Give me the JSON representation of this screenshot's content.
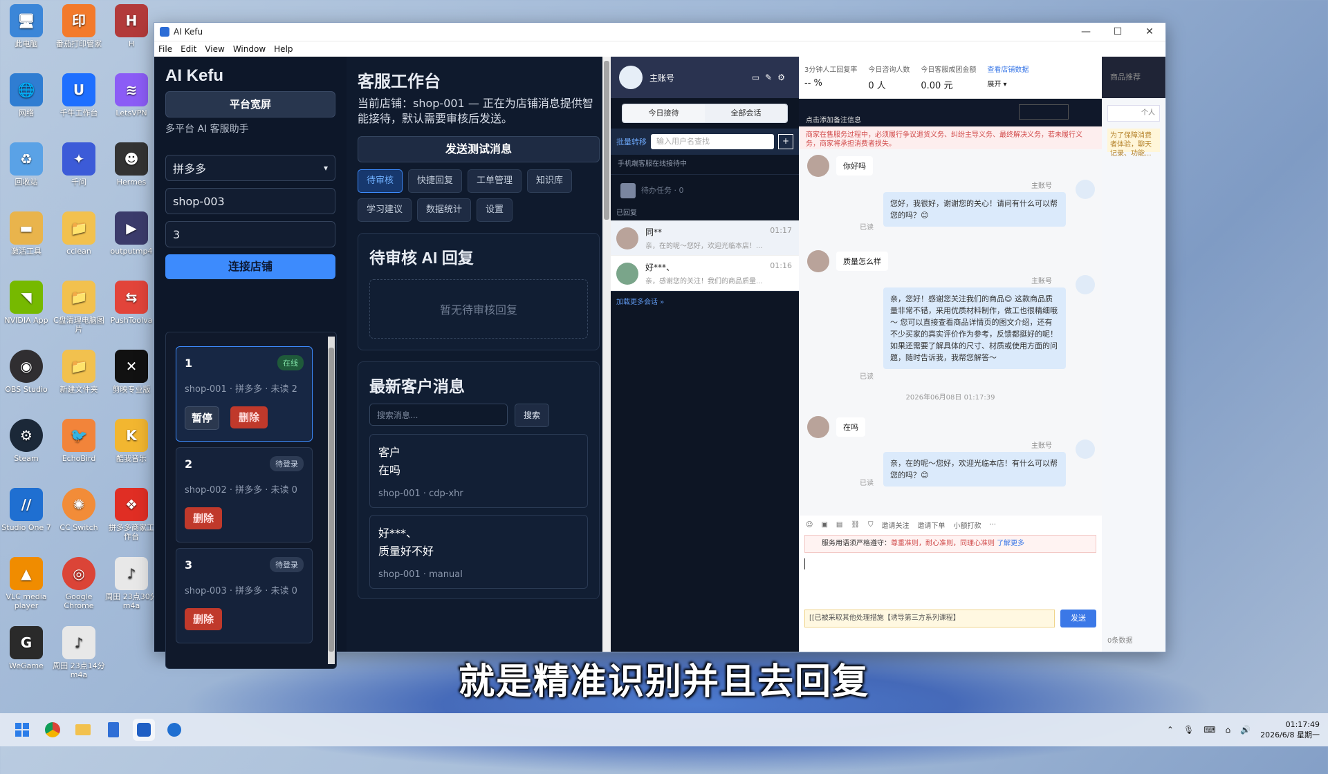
{
  "desktop": {
    "icons": [
      {
        "label": "此电脑",
        "color": "#3b86d8"
      },
      {
        "label": "番茄打印管家",
        "color": "#f37a2b"
      },
      {
        "label": "H",
        "color": "#b23a3a"
      },
      {
        "label": "网络",
        "color": "#2f7dd2"
      },
      {
        "label": "千牛工作台",
        "color": "#1e6fff"
      },
      {
        "label": "LetsVPN",
        "color": "#8b5cf6"
      },
      {
        "label": "回收站",
        "color": "#5aa2e6"
      },
      {
        "label": "千问",
        "color": "#3c5bd8"
      },
      {
        "label": "Hermes",
        "color": "#333333"
      },
      {
        "label": "激活工具",
        "color": "#e9b44c"
      },
      {
        "label": "cclean",
        "color": "#f2c14e"
      },
      {
        "label": "outputmp4",
        "color": "#3b3b6b"
      },
      {
        "label": "NVIDIA App",
        "color": "#76b900"
      },
      {
        "label": "C盘清理电脑图片",
        "color": "#f2c14e"
      },
      {
        "label": "PushToolva",
        "color": "#e2443a"
      },
      {
        "label": "OBS Studio",
        "color": "#302e31"
      },
      {
        "label": "新建文件夹",
        "color": "#f2c14e"
      },
      {
        "label": "剪映专业版",
        "color": "#111111"
      },
      {
        "label": "Steam",
        "color": "#1b2838"
      },
      {
        "label": "EchoBird",
        "color": "#f2843a"
      },
      {
        "label": "酷我音乐",
        "color": "#f2b630"
      },
      {
        "label": "Studio One 7",
        "color": "#1f6fd1"
      },
      {
        "label": "CC Switch",
        "color": "#f28c38"
      },
      {
        "label": "拼多多商家工作台",
        "color": "#e02e24"
      },
      {
        "label": "VLC media player",
        "color": "#f08c00"
      },
      {
        "label": "Google Chrome",
        "color": "#db4437"
      },
      {
        "label": "周田 23点30分m4a",
        "color": "#e8e8e8"
      },
      {
        "label": "WeGame",
        "color": "#2a2a2a"
      },
      {
        "label": "周田 23点14分m4a",
        "color": "#e8e8e8"
      }
    ]
  },
  "window": {
    "title": "AI Kefu",
    "menu": [
      "File",
      "Edit",
      "View",
      "Window",
      "Help"
    ],
    "controls": {
      "minimize": "—",
      "maximize": "☐",
      "close": "✕"
    }
  },
  "sidebar": {
    "brand": "AI Kefu",
    "wide_button": "平台宽屏",
    "subtitle": "多平台 AI 客服助手",
    "platform_select": "拼多多",
    "shop_id_value": "shop-003",
    "count_value": "3",
    "connect_button": "连接店铺",
    "shops": [
      {
        "num": "1",
        "status": "在线",
        "meta": "shop-001 · 拼多多 · 未读 2",
        "pause": "暂停",
        "delete": "删除"
      },
      {
        "num": "2",
        "status": "待登录",
        "meta": "shop-002 · 拼多多 · 未读 0",
        "delete": "删除"
      },
      {
        "num": "3",
        "status": "待登录",
        "meta": "shop-003 · 拼多多 · 未读 0",
        "delete": "删除"
      }
    ]
  },
  "middle": {
    "title": "客服工作台",
    "description": "当前店铺：shop-001 — 正在为店铺消息提供智能接待，默认需要审核后发送。",
    "send_test_button": "发送测试消息",
    "tabs": [
      "待审核",
      "快捷回复",
      "工单管理",
      "知识库",
      "学习建议",
      "数据统计",
      "设置"
    ],
    "pending_card": {
      "title": "待审核 AI 回复",
      "empty": "暂无待审核回复"
    },
    "latest_card": {
      "title": "最新客户消息",
      "search_placeholder": "搜索消息...",
      "search_button": "搜索",
      "messages": [
        {
          "who": "客户",
          "text": "在吗",
          "source": "shop-001 · cdp-xhr"
        },
        {
          "who": "好***、",
          "text": "质量好不好",
          "source": "shop-001 · manual"
        }
      ]
    }
  },
  "chat_app": {
    "account": "主账号",
    "segments": [
      "今日接待",
      "全部会话"
    ],
    "batch_transfer": "批量转移",
    "search_placeholder": "输入用户名查找",
    "mobile_notice": "手机端客服在线接待中",
    "pending_task": "待办任务 · 0",
    "replied_label": "已回复",
    "conversations": [
      {
        "name": "同**",
        "time": "01:17",
        "preview": "亲，在的呢～您好，欢迎光临本店！..."
      },
      {
        "name": "好***、",
        "time": "01:16",
        "preview": "亲，感谢您的关注！我们的商品质量..."
      }
    ],
    "load_more": "加载更多会话 »",
    "stats": [
      {
        "label": "3分钟人工回复率",
        "value": "-- %"
      },
      {
        "label": "今日咨询人数",
        "value": "0 人"
      },
      {
        "label": "今日客服成团金额",
        "value": "0.00 元"
      }
    ],
    "store_data_link": "查看店铺数据",
    "expand": "展开 ▾",
    "add_note": "点击添加备注信息",
    "warning": "商家在售服务过程中，必须履行争议退货义务、纠纷主导义务、最终解决义务，若未履行义务，商家将承担消费者损失。",
    "chat": {
      "msg1": "你好吗",
      "seller_label": "主账号",
      "reply1": "您好，我很好，谢谢您的关心！请问有什么可以帮您的吗？😊",
      "read": "已读",
      "msg2": "质量怎么样",
      "reply2": "亲，您好！感谢您关注我们的商品😊 这款商品质量非常不错，采用优质材料制作，做工也很精细哦～ 您可以直接查看商品详情页的图文介绍，还有不少买家的真实评价作为参考，反馈都挺好的呢！如果还需要了解具体的尺寸、材质或使用方面的问题，随时告诉我，我帮您解答～",
      "timestamp": "2026年06月08日 01:17:39",
      "msg3": "在吗",
      "reply3": "亲，在的呢～您好，欢迎光临本店！有什么可以帮您的吗？😊"
    },
    "toolbar_items": [
      "邀请关注",
      "邀请下单",
      "小额打款"
    ],
    "service_notice_prefix": "服务用语须严格遵守：",
    "service_notice_rules": "尊重准则，耐心准则，同理心准则",
    "service_notice_more": "了解更多",
    "suggestion": "[[已被采取其他处理措施【诱导第三方系列课程】",
    "send_button": "发送",
    "right_panel_header": "商品推荐",
    "right_panel_mini": "个人",
    "right_panel_notice": "为了保障消费者体验，聊天记录、功能...",
    "right_panel_footer": "0条数据"
  },
  "subtitle": "就是精准识别并且去回复",
  "taskbar": {
    "time": "01:17:49",
    "date": "2026/6/8 星期一"
  }
}
